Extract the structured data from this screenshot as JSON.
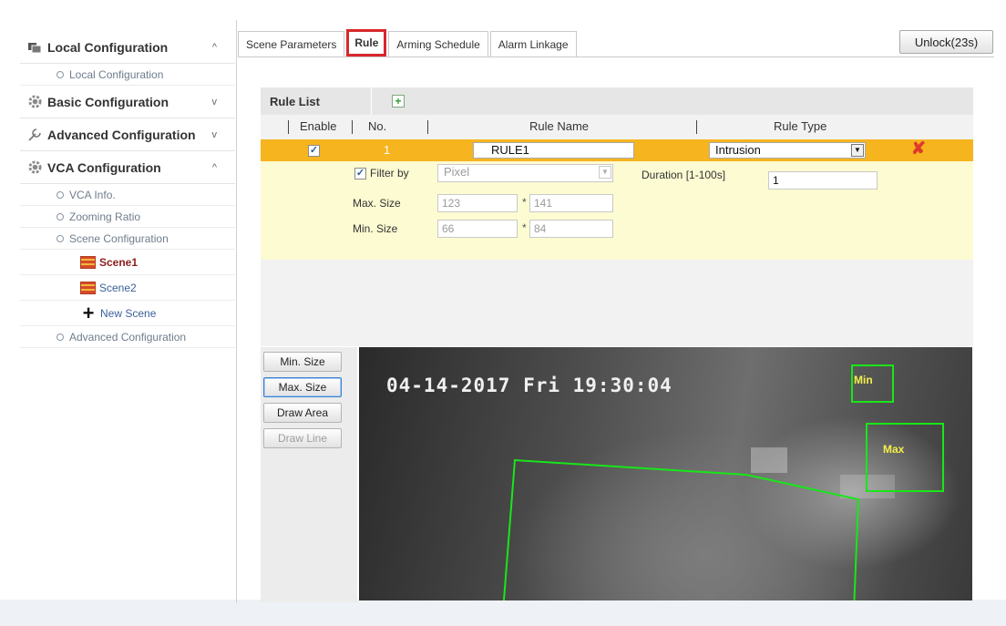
{
  "sidebar": {
    "groups": [
      {
        "label": "Local Configuration",
        "chevron": "^",
        "icon": "local-config-icon",
        "items": [
          {
            "label": "Local Configuration"
          }
        ]
      },
      {
        "label": "Basic Configuration",
        "chevron": "v",
        "icon": "gear-icon"
      },
      {
        "label": "Advanced Configuration",
        "chevron": "v",
        "icon": "wrench-icon"
      },
      {
        "label": "VCA Configuration",
        "chevron": "^",
        "icon": "gear-icon",
        "items": [
          {
            "label": "VCA Info."
          },
          {
            "label": "Zooming Ratio"
          },
          {
            "label": "Scene Configuration"
          }
        ],
        "scenes": [
          {
            "label": "Scene1",
            "active": true
          },
          {
            "label": "Scene2",
            "active": false
          },
          {
            "label": "New Scene"
          }
        ],
        "after_items": [
          {
            "label": "Advanced Configuration"
          }
        ]
      }
    ]
  },
  "tabs": [
    {
      "label": "Scene Parameters",
      "active": false
    },
    {
      "label": "Rule",
      "active": true
    },
    {
      "label": "Arming Schedule",
      "active": false
    },
    {
      "label": "Alarm Linkage",
      "active": false
    }
  ],
  "unlock_label": "Unlock(23s)",
  "rule_list": {
    "title": "Rule List",
    "columns": {
      "enable": "Enable",
      "no": "No.",
      "rule_name": "Rule Name",
      "rule_type": "Rule Type"
    },
    "row": {
      "enabled": true,
      "no": "1",
      "name": "RULE1",
      "type": "Intrusion"
    }
  },
  "filter": {
    "filter_by_label": "Filter by",
    "filter_by_checked": true,
    "filter_by_value": "Pixel",
    "duration_label": "Duration [1-100s]",
    "duration_value": "1",
    "max_size_label": "Max. Size",
    "max_size_w": "123",
    "max_size_h": "141",
    "min_size_label": "Min. Size",
    "min_size_w": "66",
    "min_size_h": "84",
    "times": "*"
  },
  "tools": [
    {
      "label": "Min. Size",
      "state": "normal"
    },
    {
      "label": "Max. Size",
      "state": "focused"
    },
    {
      "label": "Draw Area",
      "state": "normal"
    },
    {
      "label": "Draw Line",
      "state": "disabled"
    }
  ],
  "video": {
    "osd_text": "04-14-2017 Fri 19:30:04",
    "min_label": "Min",
    "max_label": "Max",
    "overlay_color": "#19e619",
    "label_color": "#f3ef4a"
  },
  "colors": {
    "active_tab_outline": "#d8272c",
    "selected_row": "#f6b41e",
    "filter_bg": "#fdfbd2"
  }
}
